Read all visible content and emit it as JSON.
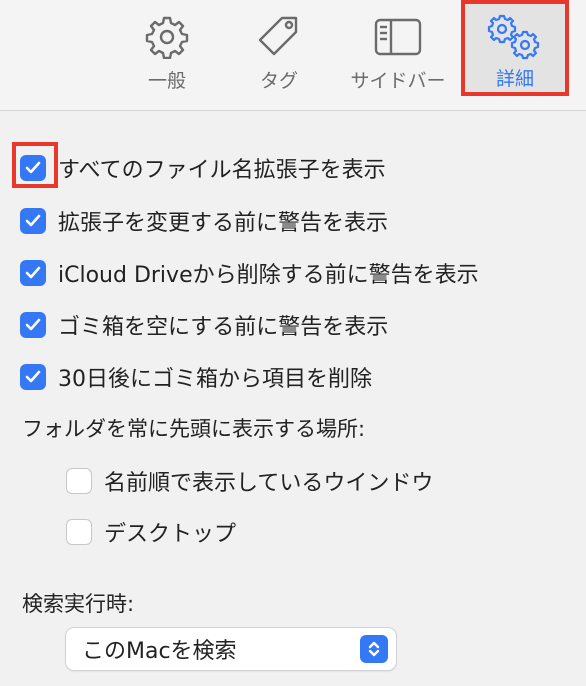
{
  "tabs": [
    {
      "id": "general",
      "label": "一般",
      "icon": "gear-icon"
    },
    {
      "id": "tags",
      "label": "タグ",
      "icon": "tag-icon"
    },
    {
      "id": "sidebar",
      "label": "サイドバー",
      "icon": "sidebar-icon"
    },
    {
      "id": "advanced",
      "label": "詳細",
      "icon": "gears-icon",
      "selected": true
    }
  ],
  "options": {
    "show_all_extensions": {
      "label": "すべてのファイル名拡張子を表示",
      "checked": true
    },
    "warn_extension_change": {
      "label": "拡張子を変更する前に警告を表示",
      "checked": true
    },
    "warn_icloud_remove": {
      "label": "iCloud Driveから削除する前に警告を表示",
      "checked": true
    },
    "warn_empty_trash": {
      "label": "ゴミ箱を空にする前に警告を表示",
      "checked": true
    },
    "remove_trash_30days": {
      "label": "30日後にゴミ箱から項目を削除",
      "checked": true
    }
  },
  "folders_on_top": {
    "title": "フォルダを常に先頭に表示する場所:",
    "name_sort_windows": {
      "label": "名前順で表示しているウインドウ",
      "checked": false
    },
    "desktop": {
      "label": "デスクトップ",
      "checked": false
    }
  },
  "search": {
    "title": "検索実行時:",
    "selected": "このMacを検索"
  },
  "colors": {
    "accent": "#3478f6",
    "highlight": "#e8382c"
  }
}
